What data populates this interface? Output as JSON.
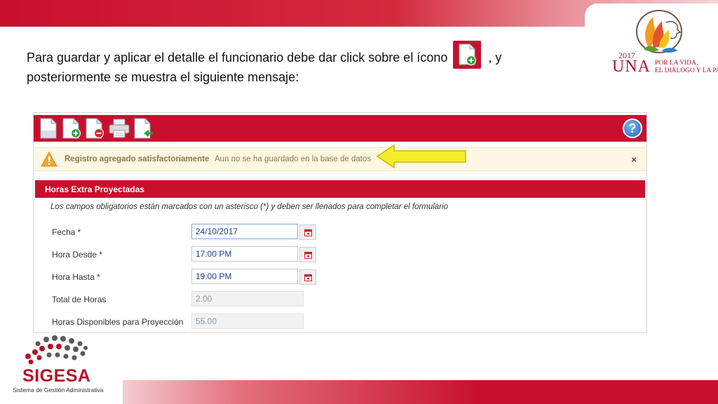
{
  "slide": {
    "instruction_part1": "Para guardar y aplicar el detalle el funcionario debe dar click sobre el ícono",
    "instruction_part2": ", y posteriormente se muestra el siguiente mensaje:",
    "inline_icon": "add-document-icon"
  },
  "una_logo": {
    "year": "2017",
    "name": "UNA",
    "tagline1": "POR LA VIDA,",
    "tagline2": "EL DIÁLOGO Y LA PAZ"
  },
  "toolbar": {
    "buttons": [
      "new-document-icon",
      "add-document-icon",
      "delete-document-icon",
      "print-icon",
      "return-document-icon"
    ],
    "help_label": "?"
  },
  "alert": {
    "title": "Registro agregado satisfactoriamente",
    "message": "Aun no se ha guardado en la base de datos",
    "close_label": "×"
  },
  "form": {
    "section_title": "Horas Extra Proyectadas",
    "required_note": "Los campos obligatorios están marcados con un asterisco (*) y deben ser llenados para completar el formulario",
    "fields": [
      {
        "label": "Fecha *",
        "value": "24/10/2017"
      },
      {
        "label": "Hora Desde *",
        "value": "17:00 PM"
      },
      {
        "label": "Hora Hasta *",
        "value": "19:00 PM"
      },
      {
        "label": "Total de Horas",
        "value": "2.00"
      },
      {
        "label": "Horas Disponibles para Proyección",
        "value": "55.00"
      }
    ]
  },
  "sigesa_logo": {
    "name": "SIGESA",
    "subtitle": "Sistema de Gestión Administrativa"
  },
  "colors": {
    "brand_red": "#c8102e",
    "alert_bg": "#fcf8e3",
    "arrow_yellow": "#f5ee2a"
  }
}
